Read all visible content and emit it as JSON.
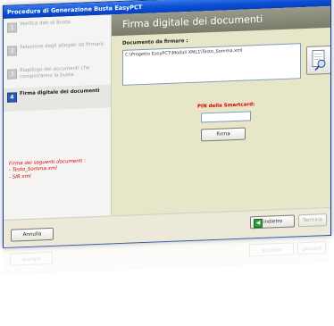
{
  "window": {
    "title": "Procedura di Generazione Busta EasyPCT"
  },
  "sidebar": {
    "steps": [
      {
        "num": "1",
        "label": "Verifica dati di Busta"
      },
      {
        "num": "2",
        "label": "Selezione degli allegati da firmare"
      },
      {
        "num": "3",
        "label": "Riepilogo dei documenti che comporranno la busta"
      },
      {
        "num": "4",
        "label": "Firma digitale dei documenti"
      }
    ],
    "sign_info": {
      "heading": "Firma dei seguenti documenti :",
      "items": [
        "- Testo_Somma.xml",
        "- SIR.xml"
      ]
    }
  },
  "main": {
    "banner_title": "Firma digitale dei documenti",
    "doc_label": "Documento da firmare :",
    "doc_path": "C:\\Progetto EasyPCT\\Moduli XML1\\Testo_Somma.xml",
    "pin_label": "PIN della Smartcard:",
    "pin_value": "",
    "firma_label": "Firma"
  },
  "footer": {
    "annulla_label": "Annulla",
    "indietro_label": "Indietro",
    "avanti_label": "Termina"
  },
  "colors": {
    "titlebar": "#0b4fd6",
    "accent_red": "#d40000",
    "step_active": "#2b5db8",
    "next_green": "#2f9a3a"
  }
}
